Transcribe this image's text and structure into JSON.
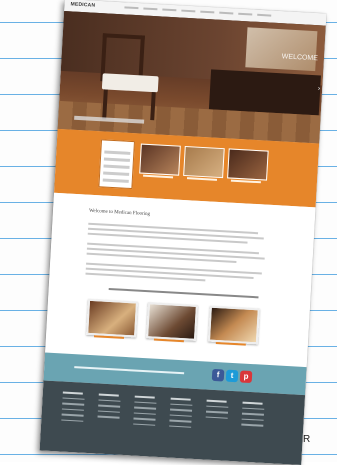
{
  "site": {
    "logo": "MEDICAN",
    "hero_title": "WELCOME",
    "hero_arrow": "›",
    "welcome_heading": "Welcome to Medican Flooring"
  },
  "social": {
    "facebook": "f",
    "twitter": "t",
    "pinterest": "p"
  },
  "paper_margin_char": "R",
  "colors": {
    "orange_band": "#e6862a",
    "social_bar": "#6aa4b2",
    "footer": "#3e4a50",
    "paper_rule": "#4fa3e0"
  }
}
